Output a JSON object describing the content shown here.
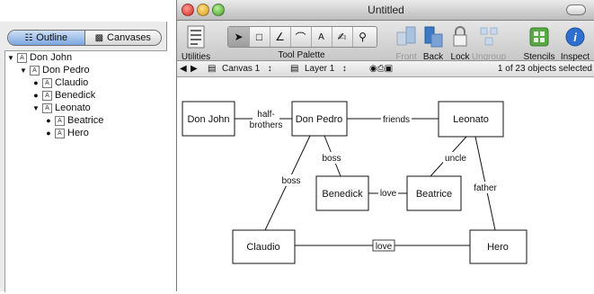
{
  "sidebar": {
    "tabs": [
      {
        "label": "Outline",
        "icon": "outline-tree-icon",
        "selected": true
      },
      {
        "label": "Canvases",
        "icon": "canvases-icon",
        "selected": false
      }
    ],
    "outline": [
      {
        "label": "Don John",
        "expander": "triangle-open"
      },
      {
        "label": "Don Pedro",
        "expander": "triangle-open"
      },
      {
        "label": "Claudio",
        "expander": "bullet"
      },
      {
        "label": "Benedick",
        "expander": "bullet"
      },
      {
        "label": "Leonato",
        "expander": "triangle-open"
      },
      {
        "label": "Beatrice",
        "expander": "bullet"
      },
      {
        "label": "Hero",
        "expander": "bullet"
      }
    ]
  },
  "window": {
    "title": "Untitled"
  },
  "toolbar": {
    "utilities_label": "Utilities",
    "tool_palette_label": "Tool Palette",
    "front_label": "Front",
    "back_label": "Back",
    "lock_label": "Lock",
    "ungroup_label": "Ungroup",
    "stencils_label": "Stencils",
    "inspect_label": "Inspect",
    "stencils_color": "#5aa845",
    "inspect_color": "#2f6fcf"
  },
  "statusbar": {
    "canvas_label": "Canvas 1",
    "layer_label": "Layer 1",
    "selection_status": "1 of 23 objects selected"
  },
  "diagram": {
    "nodes": {
      "don_john": "Don John",
      "don_pedro": "Don Pedro",
      "leonato": "Leonato",
      "benedick": "Benedick",
      "beatrice": "Beatrice",
      "claudio": "Claudio",
      "hero": "Hero"
    },
    "edges": {
      "half_brothers_line1": "half-",
      "half_brothers_line2": "brothers",
      "friends": "friends",
      "boss_benedick": "boss",
      "boss_claudio": "boss",
      "uncle": "uncle",
      "love_benedick_beatrice": "love",
      "father": "father",
      "love_claudio_hero": "love"
    }
  }
}
